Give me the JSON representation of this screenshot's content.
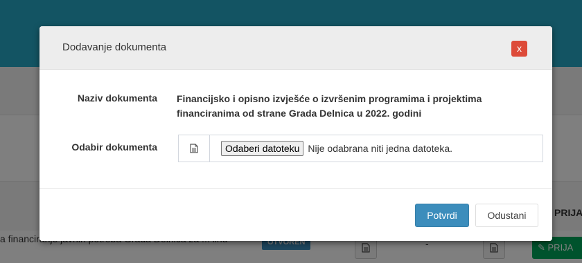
{
  "background": {
    "column_header": "PRIJA",
    "row_text": "a financiranje javnih potreba Grada Delnica za ... linu",
    "status_badge": "OTVOREN",
    "dash": "-",
    "apply_button": "PRIJA",
    "colors": {
      "header": "#27a8c7",
      "apply": "#00a65a",
      "status": "#3c8dbc"
    }
  },
  "modal": {
    "title": "Dodavanje dokumenta",
    "close_label": "x",
    "fields": {
      "name_label": "Naziv dokumenta",
      "name_value": "Financijsko i opisno izvješće o izvršenim programima i projektima financiranima od strane Grada Delnica u 2022. godini",
      "file_label": "Odabir dokumenta",
      "file_button": "Odaberi datoteku",
      "file_status": "Nije odabrana niti jedna datoteka."
    },
    "footer": {
      "confirm": "Potvrdi",
      "cancel": "Odustani"
    },
    "icons": {
      "file_field": "file-icon",
      "close": "close-icon"
    },
    "colors": {
      "close": "#dd4b39",
      "confirm": "#3c8dbc"
    }
  }
}
